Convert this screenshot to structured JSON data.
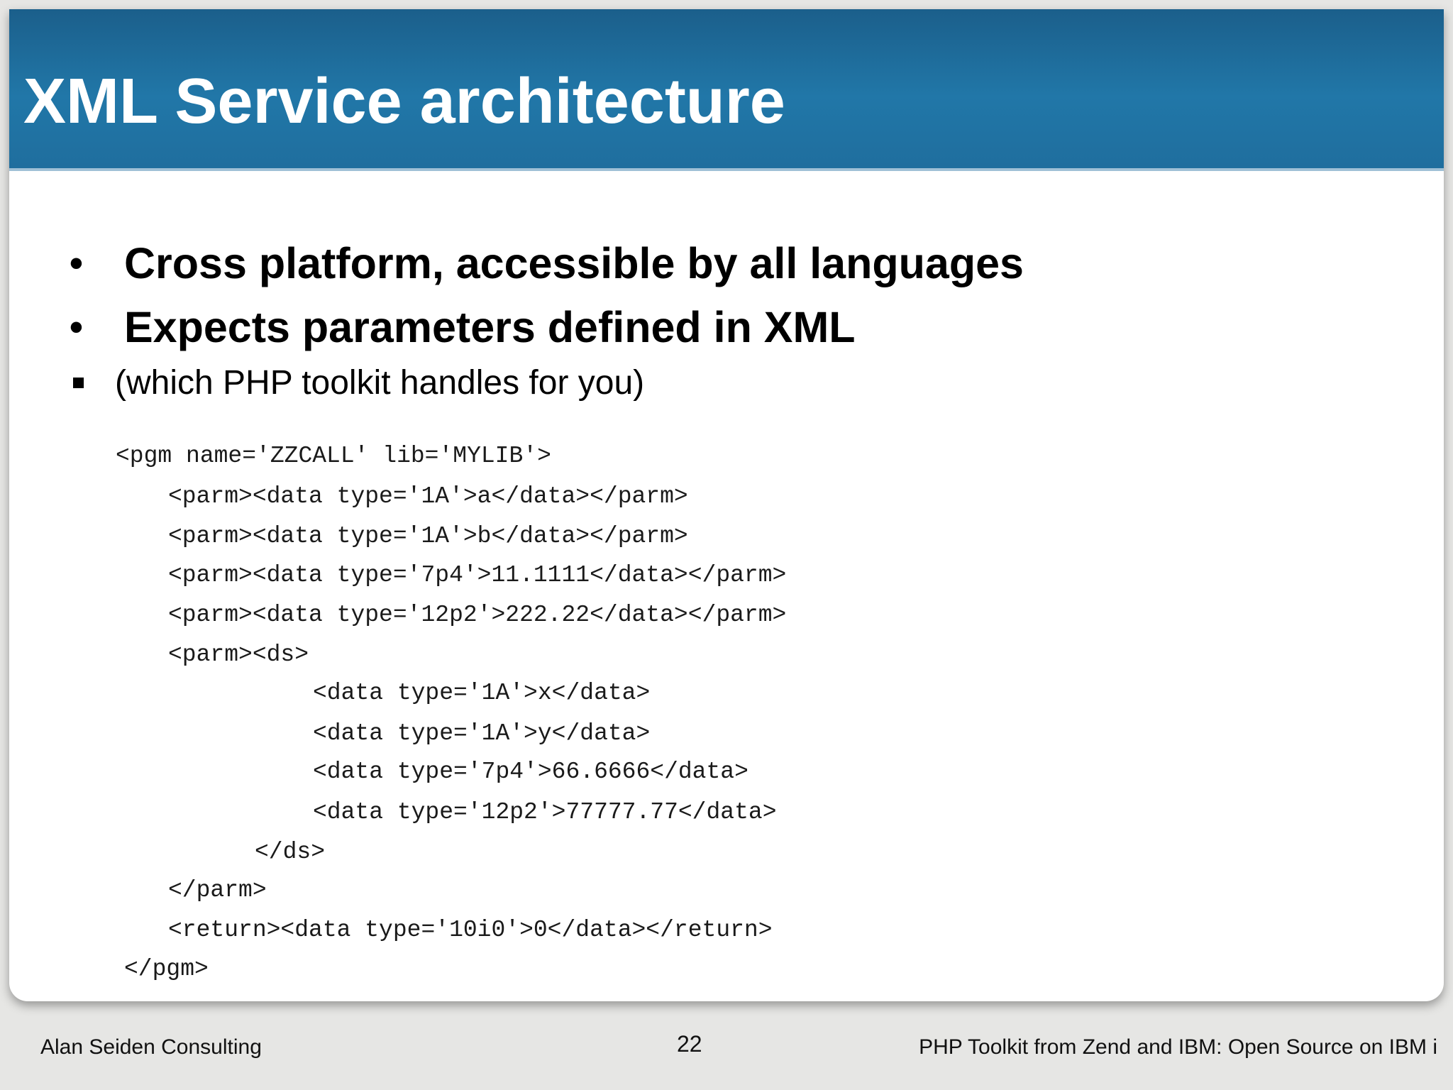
{
  "slide": {
    "title": "XML Service architecture",
    "bullets": [
      {
        "level": 1,
        "text": "Cross platform, accessible by all languages"
      },
      {
        "level": 1,
        "text": "Expects parameters defined in XML"
      },
      {
        "level": 2,
        "text": "(which PHP toolkit handles for you)"
      }
    ],
    "code_lines": [
      "<pgm name='ZZCALL' lib='MYLIB'>",
      "<parm><data type='1A'>a</data></parm>",
      "<parm><data type='1A'>b</data></parm>",
      "<parm><data type='7p4'>11.1111</data></parm>",
      "<parm><data type='12p2'>222.22</data></parm>",
      "<parm><ds>",
      "<data type='1A'>x</data>",
      "<data type='1A'>y</data>",
      "<data type='7p4'>66.6666</data>",
      "<data type='12p2'>77777.77</data>",
      "</ds>",
      "</parm>",
      "<return><data type='10i0'>0</data></return>",
      "</pgm>"
    ]
  },
  "footer": {
    "left": "Alan Seiden Consulting",
    "page_number": "22",
    "right": "PHP Toolkit from Zend and IBM: Open Source on IBM i"
  }
}
